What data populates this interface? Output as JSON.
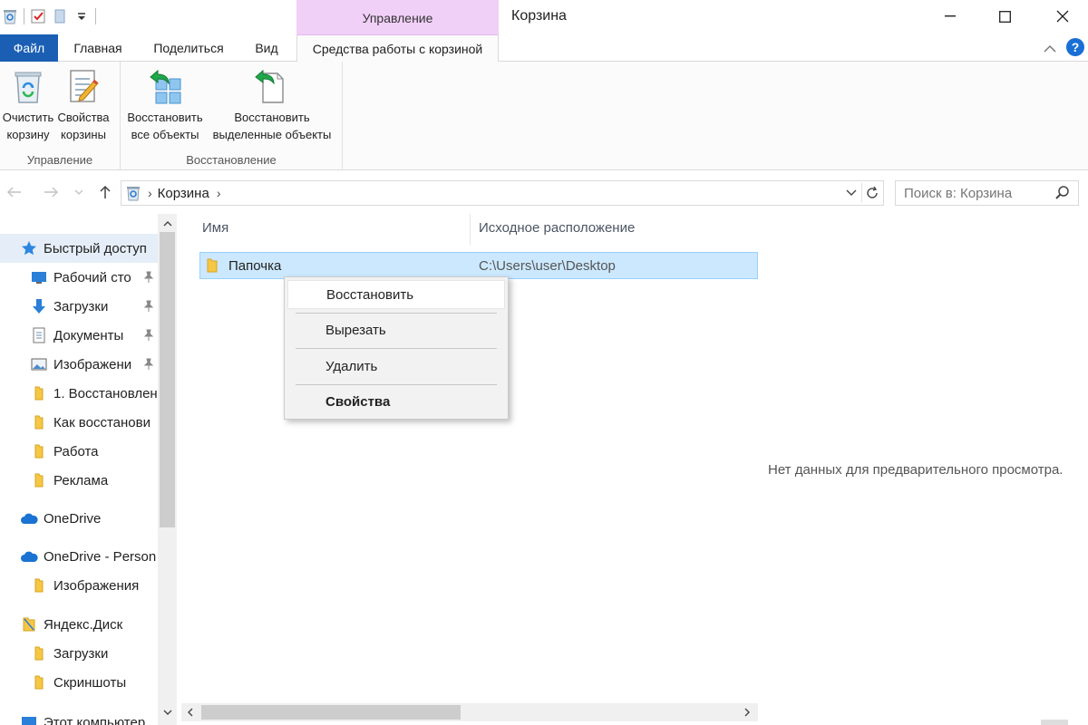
{
  "window": {
    "title": "Корзина",
    "context_group": "Управление"
  },
  "ribbon_tabs": {
    "file": "Файл",
    "home": "Главная",
    "share": "Поделиться",
    "view": "Вид",
    "recycle_tools": "Средства работы с корзиной"
  },
  "ribbon": {
    "groups": {
      "manage": "Управление",
      "restore": "Восстановление"
    },
    "buttons": {
      "empty_line1": "Очистить",
      "empty_line2": "корзину",
      "props_line1": "Свойства",
      "props_line2": "корзины",
      "restore_all_line1": "Восстановить",
      "restore_all_line2": "все объекты",
      "restore_sel_line1": "Восстановить",
      "restore_sel_line2": "выделенные объекты"
    }
  },
  "address": {
    "crumb": "Корзина",
    "search_placeholder": "Поиск в: Корзина"
  },
  "nav": {
    "items": [
      {
        "label": "Быстрый доступ"
      },
      {
        "label": "Рабочий сто"
      },
      {
        "label": "Загрузки"
      },
      {
        "label": "Документы"
      },
      {
        "label": "Изображени"
      },
      {
        "label": "1. Восстановлен"
      },
      {
        "label": "Как восстанови"
      },
      {
        "label": "Работа"
      },
      {
        "label": "Реклама"
      },
      {
        "label": "OneDrive"
      },
      {
        "label": "OneDrive - Person"
      },
      {
        "label": "Изображения"
      },
      {
        "label": "Яндекс.Диск"
      },
      {
        "label": "Загрузки"
      },
      {
        "label": "Скриншоты"
      },
      {
        "label": "Этот компьютер"
      }
    ]
  },
  "columns": {
    "name": "Имя",
    "original_location": "Исходное расположение"
  },
  "files": [
    {
      "name": "Папочка",
      "location": "C:\\Users\\user\\Desktop"
    }
  ],
  "context_menu": {
    "restore": "Восстановить",
    "cut": "Вырезать",
    "delete": "Удалить",
    "properties": "Свойства"
  },
  "preview": {
    "text": "Нет данных для предварительного просмотра."
  },
  "colors": {
    "file_tab": "#1a5fb4",
    "context_band": "#f1d0f8",
    "selection": "#cce8ff"
  }
}
